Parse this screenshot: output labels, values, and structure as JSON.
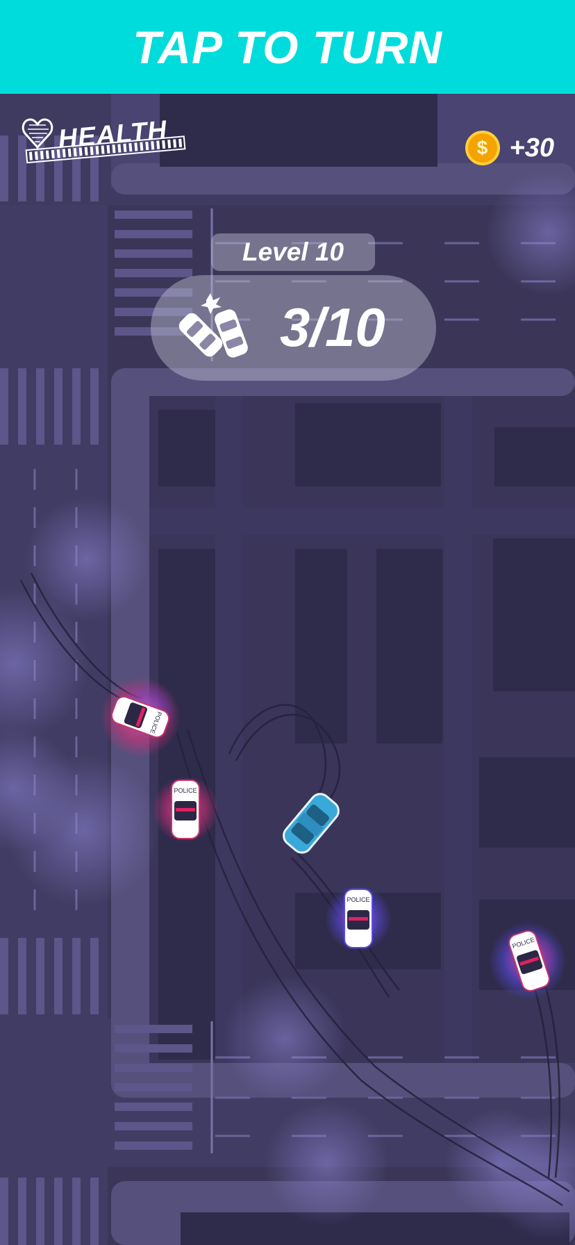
{
  "banner": {
    "text": "TAP TO TURN"
  },
  "hud": {
    "health_label": "HEALTH",
    "health_icon": "heart-icon",
    "coin_icon": "dollar-coin-icon",
    "coin_symbol": "$",
    "coin_count": "+30",
    "level_label": "Level 10",
    "crash_icon": "car-crash-icon",
    "progress": "3/10"
  },
  "colors": {
    "banner": "#00dcdc",
    "background": "#3b3658",
    "road": "#56507c",
    "building": "#34304f",
    "player_car": "#3aa8d8",
    "police_glow_red": "#e0307a",
    "police_glow_blue": "#5a4ce8"
  },
  "cars": {
    "player": "player-car",
    "police_label": "POLICE"
  }
}
